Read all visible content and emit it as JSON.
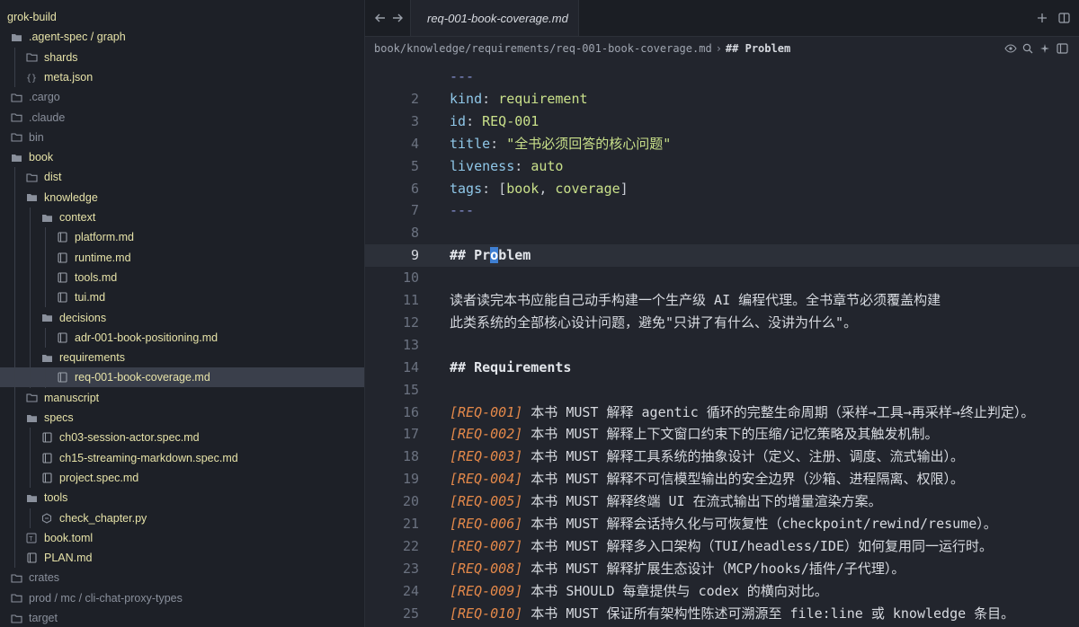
{
  "sidebar": {
    "items": [
      {
        "label": "grok-build",
        "icon": "chevron-down-icon",
        "depth": 0,
        "dim": false
      },
      {
        "label": ".agent-spec / graph",
        "icon": "folder-open-icon",
        "depth": 1,
        "dim": false
      },
      {
        "label": "shards",
        "icon": "folder-icon",
        "depth": 2,
        "dim": false
      },
      {
        "label": "meta.json",
        "icon": "braces-icon",
        "depth": 2,
        "dim": false
      },
      {
        "label": ".cargo",
        "icon": "folder-icon",
        "depth": 1,
        "dim": true
      },
      {
        "label": ".claude",
        "icon": "folder-icon",
        "depth": 1,
        "dim": true
      },
      {
        "label": "bin",
        "icon": "folder-icon",
        "depth": 1,
        "dim": true
      },
      {
        "label": "book",
        "icon": "folder-open-icon",
        "depth": 1,
        "dim": false
      },
      {
        "label": "dist",
        "icon": "folder-icon",
        "depth": 2,
        "dim": false
      },
      {
        "label": "knowledge",
        "icon": "folder-open-icon",
        "depth": 2,
        "dim": false
      },
      {
        "label": "context",
        "icon": "folder-open-icon",
        "depth": 3,
        "dim": false
      },
      {
        "label": "platform.md",
        "icon": "book-icon",
        "depth": 4,
        "dim": false
      },
      {
        "label": "runtime.md",
        "icon": "book-icon",
        "depth": 4,
        "dim": false
      },
      {
        "label": "tools.md",
        "icon": "book-icon",
        "depth": 4,
        "dim": false
      },
      {
        "label": "tui.md",
        "icon": "book-icon",
        "depth": 4,
        "dim": false
      },
      {
        "label": "decisions",
        "icon": "folder-open-icon",
        "depth": 3,
        "dim": false
      },
      {
        "label": "adr-001-book-positioning.md",
        "icon": "book-icon",
        "depth": 4,
        "dim": false
      },
      {
        "label": "requirements",
        "icon": "folder-open-icon",
        "depth": 3,
        "dim": false
      },
      {
        "label": "req-001-book-coverage.md",
        "icon": "book-icon",
        "depth": 4,
        "dim": false,
        "selected": true
      },
      {
        "label": "manuscript",
        "icon": "folder-icon",
        "depth": 2,
        "dim": false
      },
      {
        "label": "specs",
        "icon": "folder-open-icon",
        "depth": 2,
        "dim": false
      },
      {
        "label": "ch03-session-actor.spec.md",
        "icon": "book-icon",
        "depth": 3,
        "dim": false
      },
      {
        "label": "ch15-streaming-markdown.spec.md",
        "icon": "book-icon",
        "depth": 3,
        "dim": false
      },
      {
        "label": "project.spec.md",
        "icon": "book-icon",
        "depth": 3,
        "dim": false
      },
      {
        "label": "tools",
        "icon": "folder-open-icon",
        "depth": 2,
        "dim": false
      },
      {
        "label": "check_chapter.py",
        "icon": "python-icon",
        "depth": 3,
        "dim": false
      },
      {
        "label": "book.toml",
        "icon": "toml-icon",
        "depth": 2,
        "dim": false
      },
      {
        "label": "PLAN.md",
        "icon": "book-icon",
        "depth": 2,
        "dim": false
      },
      {
        "label": "crates",
        "icon": "folder-icon",
        "depth": 1,
        "dim": true
      },
      {
        "label": "prod / mc / cli-chat-proxy-types",
        "icon": "folder-icon",
        "depth": 1,
        "dim": true
      },
      {
        "label": "target",
        "icon": "folder-icon",
        "depth": 1,
        "dim": true
      }
    ]
  },
  "tabbar": {
    "active_tab": "req-001-book-coverage.md",
    "back_icon": "arrow-left-icon",
    "forward_icon": "arrow-right-icon",
    "close_icon": "close-icon",
    "new_tab_icon": "plus-icon",
    "split_icon": "split-pane-icon"
  },
  "breadcrumb": {
    "path": "book/knowledge/requirements/req-001-book-coverage.md",
    "separator": "›",
    "heading": "## Problem"
  },
  "editor": {
    "current_line": 9,
    "lines": [
      {
        "n": "",
        "parts": [
          {
            "t": "---",
            "c": "c-dash"
          }
        ]
      },
      {
        "n": "2",
        "parts": [
          {
            "t": "kind",
            "c": "c-key"
          },
          {
            "t": ": ",
            "c": "c-punct"
          },
          {
            "t": "requirement",
            "c": "c-val"
          }
        ]
      },
      {
        "n": "3",
        "parts": [
          {
            "t": "id",
            "c": "c-key"
          },
          {
            "t": ": ",
            "c": "c-punct"
          },
          {
            "t": "REQ-001",
            "c": "c-val"
          }
        ]
      },
      {
        "n": "4",
        "parts": [
          {
            "t": "title",
            "c": "c-key"
          },
          {
            "t": ": ",
            "c": "c-punct"
          },
          {
            "t": "\"全书必须回答的核心问题\"",
            "c": "c-str"
          }
        ]
      },
      {
        "n": "5",
        "parts": [
          {
            "t": "liveness",
            "c": "c-key"
          },
          {
            "t": ": ",
            "c": "c-punct"
          },
          {
            "t": "auto",
            "c": "c-val"
          }
        ]
      },
      {
        "n": "6",
        "parts": [
          {
            "t": "tags",
            "c": "c-key"
          },
          {
            "t": ": ",
            "c": "c-punct"
          },
          {
            "t": "[",
            "c": "c-punct"
          },
          {
            "t": "book",
            "c": "c-val"
          },
          {
            "t": ", ",
            "c": "c-punct"
          },
          {
            "t": "coverage",
            "c": "c-val"
          },
          {
            "t": "]",
            "c": "c-punct"
          }
        ]
      },
      {
        "n": "7",
        "parts": [
          {
            "t": "---",
            "c": "c-dash"
          }
        ]
      },
      {
        "n": "8",
        "parts": []
      },
      {
        "n": "9",
        "parts": [
          {
            "t": "## Pr",
            "c": "c-head"
          },
          {
            "t": "o",
            "c": "c-head cursor-hl"
          },
          {
            "t": "blem",
            "c": "c-head"
          }
        ]
      },
      {
        "n": "10",
        "parts": []
      },
      {
        "n": "11",
        "parts": [
          {
            "t": "读者读完本书应能自己动手构建一个生产级 AI 编程代理。全书章节必须覆盖构建",
            "c": "c-body"
          }
        ]
      },
      {
        "n": "12",
        "parts": [
          {
            "t": "此类系统的全部核心设计问题，避免\"只讲了有什么、没讲为什么\"。",
            "c": "c-body"
          }
        ]
      },
      {
        "n": "13",
        "parts": []
      },
      {
        "n": "14",
        "parts": [
          {
            "t": "## Requirements",
            "c": "c-head"
          }
        ]
      },
      {
        "n": "15",
        "parts": []
      },
      {
        "n": "16",
        "parts": [
          {
            "t": "[REQ-001]",
            "c": "c-tag"
          },
          {
            "t": " 本书 MUST 解释 agentic 循环的完整生命周期（采样→工具→再采样→终止判定）。",
            "c": "c-body"
          }
        ]
      },
      {
        "n": "17",
        "parts": [
          {
            "t": "[REQ-002]",
            "c": "c-tag"
          },
          {
            "t": " 本书 MUST 解释上下文窗口约束下的压缩/记忆策略及其触发机制。",
            "c": "c-body"
          }
        ]
      },
      {
        "n": "18",
        "parts": [
          {
            "t": "[REQ-003]",
            "c": "c-tag"
          },
          {
            "t": " 本书 MUST 解释工具系统的抽象设计（定义、注册、调度、流式输出）。",
            "c": "c-body"
          }
        ]
      },
      {
        "n": "19",
        "parts": [
          {
            "t": "[REQ-004]",
            "c": "c-tag"
          },
          {
            "t": " 本书 MUST 解释不可信模型输出的安全边界（沙箱、进程隔离、权限）。",
            "c": "c-body"
          }
        ]
      },
      {
        "n": "20",
        "parts": [
          {
            "t": "[REQ-005]",
            "c": "c-tag"
          },
          {
            "t": " 本书 MUST 解释终端 UI 在流式输出下的增量渲染方案。",
            "c": "c-body"
          }
        ]
      },
      {
        "n": "21",
        "parts": [
          {
            "t": "[REQ-006]",
            "c": "c-tag"
          },
          {
            "t": " 本书 MUST 解释会话持久化与可恢复性（checkpoint/rewind/resume）。",
            "c": "c-body"
          }
        ]
      },
      {
        "n": "22",
        "parts": [
          {
            "t": "[REQ-007]",
            "c": "c-tag"
          },
          {
            "t": " 本书 MUST 解释多入口架构（TUI/headless/IDE）如何复用同一运行时。",
            "c": "c-body"
          }
        ]
      },
      {
        "n": "23",
        "parts": [
          {
            "t": "[REQ-008]",
            "c": "c-tag"
          },
          {
            "t": " 本书 MUST 解释扩展生态设计（MCP/hooks/插件/子代理）。",
            "c": "c-body"
          }
        ]
      },
      {
        "n": "24",
        "parts": [
          {
            "t": "[REQ-009]",
            "c": "c-tag"
          },
          {
            "t": " 本书 SHOULD 每章提供与 codex 的横向对比。",
            "c": "c-body"
          }
        ]
      },
      {
        "n": "25",
        "parts": [
          {
            "t": "[REQ-010]",
            "c": "c-tag"
          },
          {
            "t": " 本书 MUST 保证所有架构性陈述可溯源至 file:line 或 knowledge 条目。",
            "c": "c-body"
          }
        ]
      }
    ]
  },
  "colors": {
    "accent": "#3f7fd2",
    "folder": "#8a909c",
    "file_label": "#e6e2a8",
    "tag": "#e5894a",
    "key": "#8fc7e8"
  }
}
